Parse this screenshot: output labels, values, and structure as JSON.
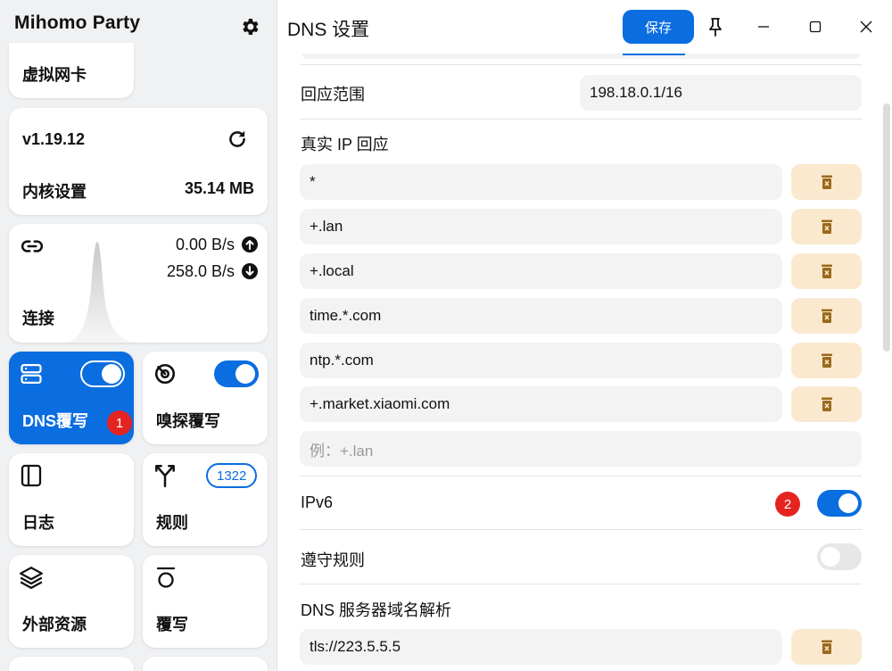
{
  "app": {
    "title": "Mihomo Party"
  },
  "sidebar": {
    "top_card_label": "虚拟网卡",
    "core": {
      "version": "v1.19.12",
      "settings_label": "内核设置",
      "memory": "35.14 MB"
    },
    "connections": {
      "label": "连接",
      "upload": "0.00 B/s",
      "download": "258.0 B/s"
    },
    "dns_override": {
      "label": "DNS覆写",
      "enabled": true,
      "badge": "1"
    },
    "sniff_override": {
      "label": "嗅探覆写",
      "enabled": true
    },
    "logs": {
      "label": "日志"
    },
    "rules": {
      "label": "规则",
      "count": "1322"
    },
    "external_resources": {
      "label": "外部资源"
    },
    "override": {
      "label": "覆写"
    }
  },
  "header": {
    "title": "DNS 设置",
    "save_label": "保存"
  },
  "content": {
    "response_range": {
      "label": "回应范围",
      "value": "198.18.0.1/16"
    },
    "real_ip": {
      "label": "真实 IP 回应",
      "items": [
        "*",
        "+.lan",
        "+.local",
        "time.*.com",
        "ntp.*.com",
        "+.market.xiaomi.com"
      ],
      "placeholder": "例：+.lan"
    },
    "ipv6": {
      "label": "IPv6",
      "enabled": true,
      "badge": "2"
    },
    "respect_rules": {
      "label": "遵守规则",
      "enabled": false
    },
    "server_resolution": {
      "label": "DNS 服务器域名解析",
      "items": [
        "tls://223.5.5.5"
      ]
    }
  },
  "colors": {
    "accent": "#0a6de0",
    "delete_bg": "#fbe9cf",
    "delete_icon": "#9a6a1c",
    "badge_red": "#e52421"
  }
}
